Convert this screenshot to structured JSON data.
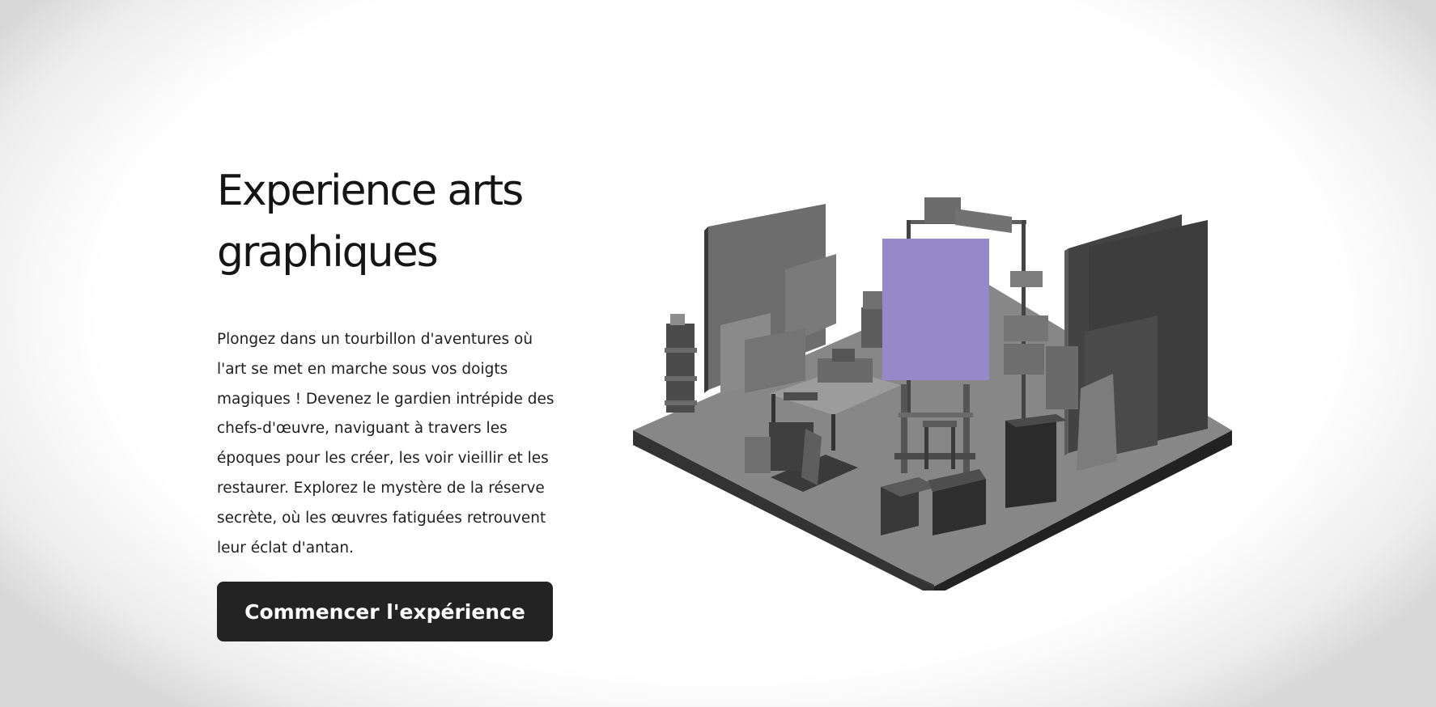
{
  "hero": {
    "title": "Experience arts graphiques",
    "description": "Plongez dans un tourbillon d'aventures où l'art se met en marche sous vos doigts magiques ! Devenez le gardien intrépide des chefs-d'œuvre, naviguant à travers les époques pour les créer, les voir vieillir et les restaurer. Explorez le mystère de la réserve secrète, où les œuvres fatiguées retrouvent leur éclat d'antan.",
    "cta_label": "Commencer l'expérience"
  },
  "scene": {
    "subject": "isometric-art-studio",
    "highlight_color": "#9589c9",
    "floor_color": "#777777",
    "object_color": "#555555"
  }
}
